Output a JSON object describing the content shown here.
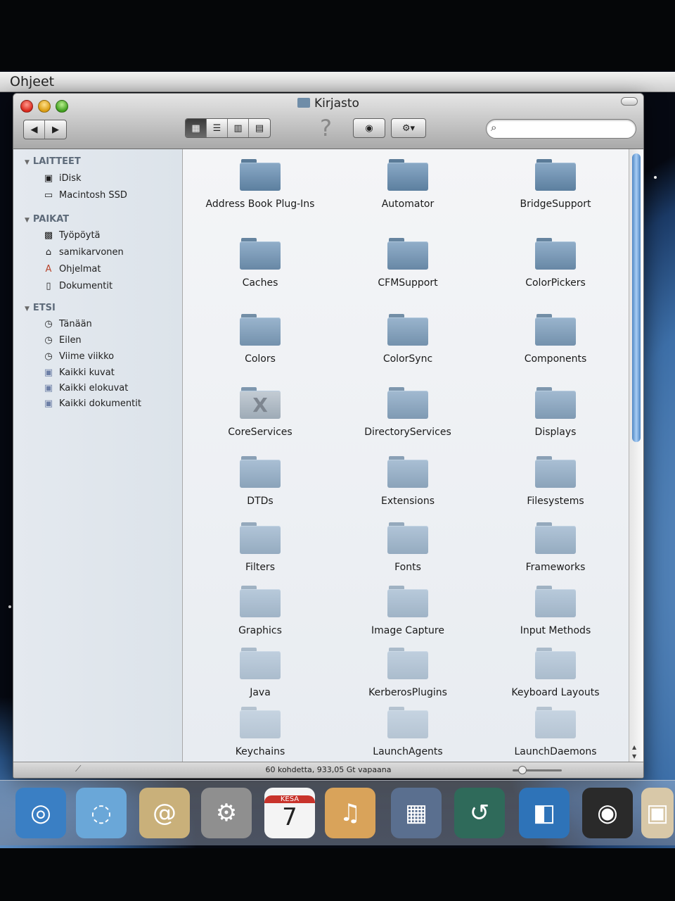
{
  "menubar": {
    "app_name": "Ohjeet"
  },
  "window": {
    "title": "Kirjasto",
    "search": {
      "placeholder": "",
      "value": ""
    }
  },
  "sidebar": {
    "devices": {
      "header": "LAITTEET",
      "items": [
        {
          "label": "iDisk",
          "icon": "idisk-icon"
        },
        {
          "label": "Macintosh SSD",
          "icon": "hard-drive-icon"
        }
      ]
    },
    "places": {
      "header": "PAIKAT",
      "items": [
        {
          "label": "Työpöytä",
          "icon": "desktop-icon"
        },
        {
          "label": "samikarvonen",
          "icon": "home-icon"
        },
        {
          "label": "Ohjelmat",
          "icon": "applications-icon"
        },
        {
          "label": "Dokumentit",
          "icon": "documents-icon"
        }
      ]
    },
    "search": {
      "header": "ETSI",
      "items": [
        {
          "label": "Tänään",
          "icon": "clock-icon"
        },
        {
          "label": "Eilen",
          "icon": "clock-icon"
        },
        {
          "label": "Viime viikko",
          "icon": "clock-icon"
        },
        {
          "label": "Kaikki kuvat",
          "icon": "smart-folder-icon"
        },
        {
          "label": "Kaikki elokuvat",
          "icon": "smart-folder-icon"
        },
        {
          "label": "Kaikki dokumentit",
          "icon": "smart-folder-icon"
        }
      ]
    }
  },
  "folders": [
    "Address Book Plug-Ins",
    "Automator",
    "BridgeSupport",
    "Caches",
    "CFMSupport",
    "ColorPickers",
    "Colors",
    "ColorSync",
    "Components",
    "CoreServices",
    "DirectoryServices",
    "Displays",
    "DTDs",
    "Extensions",
    "Filesystems",
    "Filters",
    "Fonts",
    "Frameworks",
    "Graphics",
    "Image Capture",
    "Input Methods",
    "Java",
    "KerberosPlugins",
    "Keyboard Layouts",
    "Keychains",
    "LaunchAgents",
    "LaunchDaemons"
  ],
  "status": {
    "text": "60 kohdetta, 933,05 Gt vapaana"
  },
  "dock": [
    "safari-icon",
    "ichat-icon",
    "address-book-icon",
    "system-preferences-icon",
    "ical-icon",
    "garageband-icon",
    "spaces-icon",
    "time-machine-icon",
    "office-icon",
    "dvd-player-icon",
    "iphoto-icon"
  ],
  "ical": {
    "month": "KESÄ",
    "day": "7"
  },
  "colors": {
    "accent": "#4f86c4",
    "folder": "#6f8da8",
    "sidebar_bg": "#e4e9ef"
  }
}
